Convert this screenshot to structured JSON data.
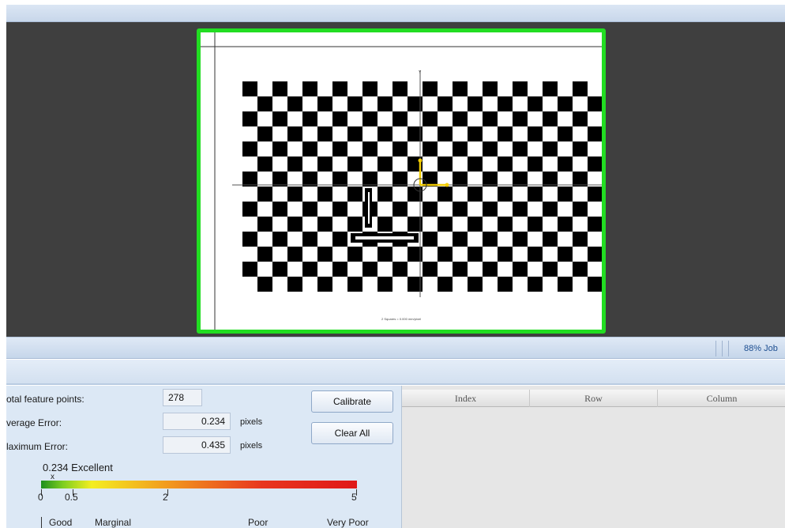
{
  "status": {
    "text": "88% Job"
  },
  "calibration_image": {
    "caption": "2 Squares = 0.000 mm/pixel",
    "axis_label": "Y"
  },
  "stats": {
    "total_label": "otal feature points:",
    "total_value": "278",
    "avg_label": "verage Error:",
    "avg_value": "0.234",
    "avg_unit": "pixels",
    "max_label": "laximum Error:",
    "max_value": "0.435",
    "max_unit": "pixels"
  },
  "buttons": {
    "calibrate": "Calibrate",
    "clear_all": "Clear All"
  },
  "quality_meter": {
    "readout": "0.234 Excellent",
    "marker": "x",
    "value": 0.234,
    "scale": [
      0,
      5
    ],
    "ticks": [
      "0",
      "0.5",
      "2",
      "5"
    ],
    "labels": [
      "Good",
      "Marginal",
      "Poor",
      "Very Poor"
    ],
    "colors": {
      "good": "#1e8f1e",
      "marginal": "#f4ee20",
      "poor": "#f29a1e",
      "very_poor": "#e01818"
    }
  },
  "results_table": {
    "columns": [
      "Index",
      "Row",
      "Column"
    ]
  },
  "colors": {
    "frame_border": "#22dd22",
    "viewer_bg": "#3f3f3f",
    "panel_bg": "#dce8f5",
    "origin_axes": "#f2cc00"
  }
}
